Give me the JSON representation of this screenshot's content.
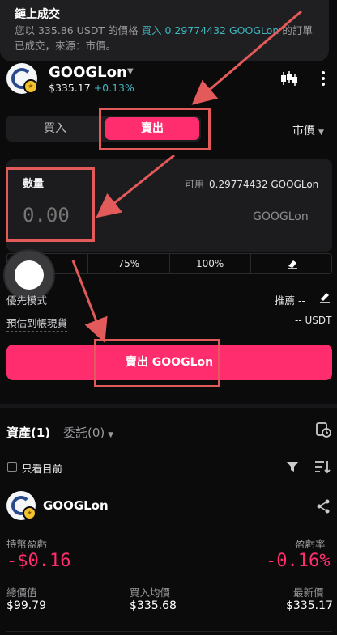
{
  "toast": {
    "title": "鏈上成交",
    "body_prefix": "您以 335.86 USDT 的價格 ",
    "body_highlight": "買入 0.29774432 GOOGLon",
    "body_suffix": " 的訂單已成交，來源：市價。"
  },
  "header": {
    "symbol": "GOOGLon",
    "price": "$335.17",
    "change": "+0.13%"
  },
  "trade_tabs": {
    "buy": "買入",
    "sell": "賣出"
  },
  "order_type": "市價",
  "quantity": {
    "label": "數量",
    "placeholder": "0.00",
    "available_label": "可用",
    "available_value": "0.29774432 GOOGLon",
    "unit": "GOOGLon"
  },
  "percent_options": [
    "%",
    "75%",
    "100%"
  ],
  "preference": {
    "label": "優先模式",
    "value": "推薦 --"
  },
  "estimate": {
    "label": "預估到帳現貨",
    "value": "-- USDT"
  },
  "sell_button": "賣出 GOOGLon",
  "section_tabs": {
    "assets": "資產(1)",
    "orders": "委託(0)"
  },
  "filter": {
    "only_current": "只看目前"
  },
  "position": {
    "symbol": "GOOGLon",
    "pnl_label": "持幣盈虧",
    "pnl_value": "-$0.16",
    "pnl_rate_label": "盈虧率",
    "pnl_rate_value": "-0.16%",
    "total_label": "總價值",
    "total_value": "$99.79",
    "avg_label": "買入均價",
    "avg_value": "$335.68",
    "latest_label": "最新價",
    "latest_value": "$335.17"
  },
  "colors": {
    "accent": "#ff2d6d",
    "teal": "#3fb6c0",
    "annotation": "#e35a5a"
  }
}
